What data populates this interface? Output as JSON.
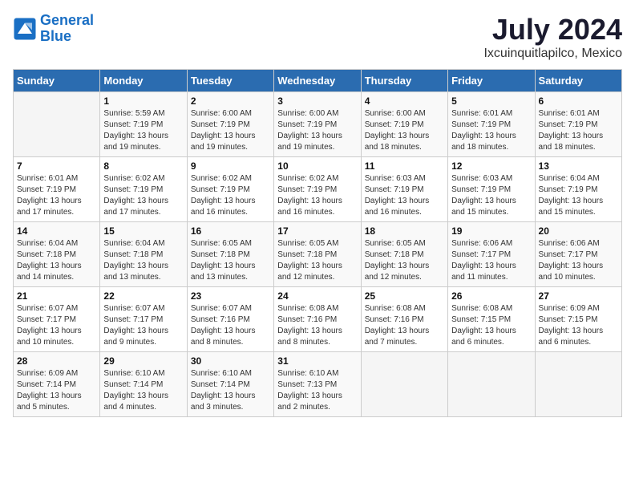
{
  "logo": {
    "line1": "General",
    "line2": "Blue"
  },
  "title": "July 2024",
  "subtitle": "Ixcuinquitlapilco, Mexico",
  "weekdays": [
    "Sunday",
    "Monday",
    "Tuesday",
    "Wednesday",
    "Thursday",
    "Friday",
    "Saturday"
  ],
  "weeks": [
    [
      {
        "day": "",
        "sunrise": "",
        "sunset": "",
        "daylight": ""
      },
      {
        "day": "1",
        "sunrise": "Sunrise: 5:59 AM",
        "sunset": "Sunset: 7:19 PM",
        "daylight": "Daylight: 13 hours and 19 minutes."
      },
      {
        "day": "2",
        "sunrise": "Sunrise: 6:00 AM",
        "sunset": "Sunset: 7:19 PM",
        "daylight": "Daylight: 13 hours and 19 minutes."
      },
      {
        "day": "3",
        "sunrise": "Sunrise: 6:00 AM",
        "sunset": "Sunset: 7:19 PM",
        "daylight": "Daylight: 13 hours and 19 minutes."
      },
      {
        "day": "4",
        "sunrise": "Sunrise: 6:00 AM",
        "sunset": "Sunset: 7:19 PM",
        "daylight": "Daylight: 13 hours and 18 minutes."
      },
      {
        "day": "5",
        "sunrise": "Sunrise: 6:01 AM",
        "sunset": "Sunset: 7:19 PM",
        "daylight": "Daylight: 13 hours and 18 minutes."
      },
      {
        "day": "6",
        "sunrise": "Sunrise: 6:01 AM",
        "sunset": "Sunset: 7:19 PM",
        "daylight": "Daylight: 13 hours and 18 minutes."
      }
    ],
    [
      {
        "day": "7",
        "sunrise": "Sunrise: 6:01 AM",
        "sunset": "Sunset: 7:19 PM",
        "daylight": "Daylight: 13 hours and 17 minutes."
      },
      {
        "day": "8",
        "sunrise": "Sunrise: 6:02 AM",
        "sunset": "Sunset: 7:19 PM",
        "daylight": "Daylight: 13 hours and 17 minutes."
      },
      {
        "day": "9",
        "sunrise": "Sunrise: 6:02 AM",
        "sunset": "Sunset: 7:19 PM",
        "daylight": "Daylight: 13 hours and 16 minutes."
      },
      {
        "day": "10",
        "sunrise": "Sunrise: 6:02 AM",
        "sunset": "Sunset: 7:19 PM",
        "daylight": "Daylight: 13 hours and 16 minutes."
      },
      {
        "day": "11",
        "sunrise": "Sunrise: 6:03 AM",
        "sunset": "Sunset: 7:19 PM",
        "daylight": "Daylight: 13 hours and 16 minutes."
      },
      {
        "day": "12",
        "sunrise": "Sunrise: 6:03 AM",
        "sunset": "Sunset: 7:19 PM",
        "daylight": "Daylight: 13 hours and 15 minutes."
      },
      {
        "day": "13",
        "sunrise": "Sunrise: 6:04 AM",
        "sunset": "Sunset: 7:19 PM",
        "daylight": "Daylight: 13 hours and 15 minutes."
      }
    ],
    [
      {
        "day": "14",
        "sunrise": "Sunrise: 6:04 AM",
        "sunset": "Sunset: 7:18 PM",
        "daylight": "Daylight: 13 hours and 14 minutes."
      },
      {
        "day": "15",
        "sunrise": "Sunrise: 6:04 AM",
        "sunset": "Sunset: 7:18 PM",
        "daylight": "Daylight: 13 hours and 13 minutes."
      },
      {
        "day": "16",
        "sunrise": "Sunrise: 6:05 AM",
        "sunset": "Sunset: 7:18 PM",
        "daylight": "Daylight: 13 hours and 13 minutes."
      },
      {
        "day": "17",
        "sunrise": "Sunrise: 6:05 AM",
        "sunset": "Sunset: 7:18 PM",
        "daylight": "Daylight: 13 hours and 12 minutes."
      },
      {
        "day": "18",
        "sunrise": "Sunrise: 6:05 AM",
        "sunset": "Sunset: 7:18 PM",
        "daylight": "Daylight: 13 hours and 12 minutes."
      },
      {
        "day": "19",
        "sunrise": "Sunrise: 6:06 AM",
        "sunset": "Sunset: 7:17 PM",
        "daylight": "Daylight: 13 hours and 11 minutes."
      },
      {
        "day": "20",
        "sunrise": "Sunrise: 6:06 AM",
        "sunset": "Sunset: 7:17 PM",
        "daylight": "Daylight: 13 hours and 10 minutes."
      }
    ],
    [
      {
        "day": "21",
        "sunrise": "Sunrise: 6:07 AM",
        "sunset": "Sunset: 7:17 PM",
        "daylight": "Daylight: 13 hours and 10 minutes."
      },
      {
        "day": "22",
        "sunrise": "Sunrise: 6:07 AM",
        "sunset": "Sunset: 7:17 PM",
        "daylight": "Daylight: 13 hours and 9 minutes."
      },
      {
        "day": "23",
        "sunrise": "Sunrise: 6:07 AM",
        "sunset": "Sunset: 7:16 PM",
        "daylight": "Daylight: 13 hours and 8 minutes."
      },
      {
        "day": "24",
        "sunrise": "Sunrise: 6:08 AM",
        "sunset": "Sunset: 7:16 PM",
        "daylight": "Daylight: 13 hours and 8 minutes."
      },
      {
        "day": "25",
        "sunrise": "Sunrise: 6:08 AM",
        "sunset": "Sunset: 7:16 PM",
        "daylight": "Daylight: 13 hours and 7 minutes."
      },
      {
        "day": "26",
        "sunrise": "Sunrise: 6:08 AM",
        "sunset": "Sunset: 7:15 PM",
        "daylight": "Daylight: 13 hours and 6 minutes."
      },
      {
        "day": "27",
        "sunrise": "Sunrise: 6:09 AM",
        "sunset": "Sunset: 7:15 PM",
        "daylight": "Daylight: 13 hours and 6 minutes."
      }
    ],
    [
      {
        "day": "28",
        "sunrise": "Sunrise: 6:09 AM",
        "sunset": "Sunset: 7:14 PM",
        "daylight": "Daylight: 13 hours and 5 minutes."
      },
      {
        "day": "29",
        "sunrise": "Sunrise: 6:10 AM",
        "sunset": "Sunset: 7:14 PM",
        "daylight": "Daylight: 13 hours and 4 minutes."
      },
      {
        "day": "30",
        "sunrise": "Sunrise: 6:10 AM",
        "sunset": "Sunset: 7:14 PM",
        "daylight": "Daylight: 13 hours and 3 minutes."
      },
      {
        "day": "31",
        "sunrise": "Sunrise: 6:10 AM",
        "sunset": "Sunset: 7:13 PM",
        "daylight": "Daylight: 13 hours and 2 minutes."
      },
      {
        "day": "",
        "sunrise": "",
        "sunset": "",
        "daylight": ""
      },
      {
        "day": "",
        "sunrise": "",
        "sunset": "",
        "daylight": ""
      },
      {
        "day": "",
        "sunrise": "",
        "sunset": "",
        "daylight": ""
      }
    ]
  ]
}
